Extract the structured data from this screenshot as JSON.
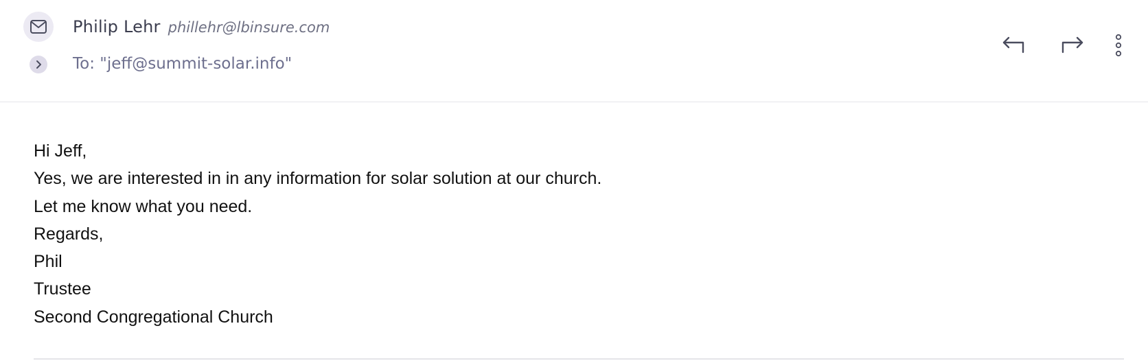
{
  "message": {
    "sender_name": "Philip Lehr",
    "sender_email": "phillehr@lbinsure.com",
    "recipient": "To: \"jeff@summit-solar.info\"",
    "avatar_icon": "mail-icon",
    "expand_icon": "chevron-right-icon",
    "actions": {
      "reply_icon": "reply-icon",
      "forward_icon": "forward-icon",
      "more_icon": "more-vertical-icon"
    },
    "body_lines": [
      "Hi Jeff,",
      "Yes, we are interested in in any information for solar solution at our church.",
      "Let me know what you need.",
      "Regards,",
      "Phil",
      "Trustee",
      "Second Congregational Church"
    ]
  },
  "colors": {
    "sender_name": "#3c3e4f",
    "sender_email": "#6e7083",
    "recipient": "#6d6f8e",
    "icon": "#4a4c5e",
    "avatar_bg": "#eceaf3",
    "toggle_bg": "#dedbe9",
    "divider": "#e6e6ea",
    "body_text": "#111111"
  }
}
